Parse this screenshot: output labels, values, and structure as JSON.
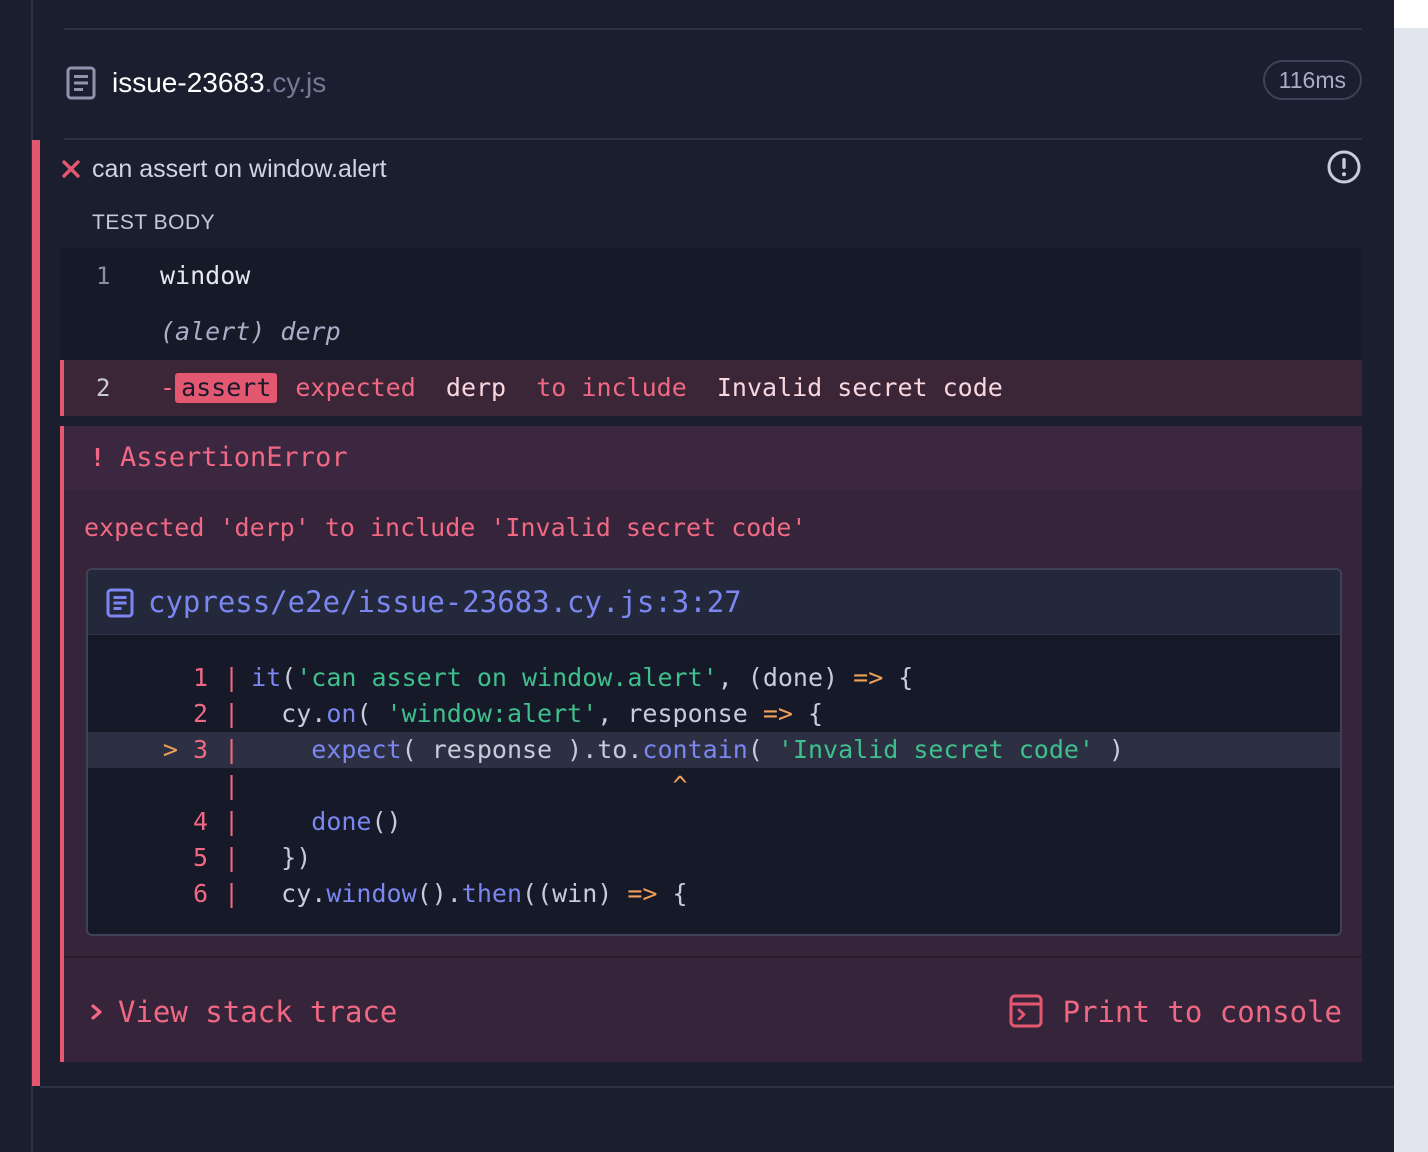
{
  "spec": {
    "name": "issue-23683",
    "extension": ".cy.js",
    "duration": "116ms"
  },
  "test": {
    "title": "can assert on window.alert",
    "status_icon": "x-icon",
    "section_label": "TEST BODY"
  },
  "commands": [
    {
      "number": "1",
      "text": "window"
    },
    {
      "number": "",
      "text": "(alert)  derp"
    },
    {
      "number": "2",
      "dash": "-",
      "name": "assert",
      "message_parts": [
        "expected",
        "derp",
        "to include",
        "Invalid secret code"
      ]
    }
  ],
  "error": {
    "bang": "!",
    "name": "AssertionError",
    "message": "expected 'derp' to include 'Invalid secret code'",
    "file_path": "cypress/e2e/issue-23683.cy.js:3:27"
  },
  "code_lines": [
    {
      "gutter": "1",
      "pointer": "",
      "tokens": [
        [
          "fn",
          "it"
        ],
        [
          "plain",
          "("
        ],
        [
          "str",
          "'can assert on window.alert'"
        ],
        [
          "plain",
          ", (done) "
        ],
        [
          "arrow",
          "=>"
        ],
        [
          "plain",
          " {"
        ]
      ]
    },
    {
      "gutter": "2",
      "pointer": "",
      "tokens": [
        [
          "plain",
          "  cy."
        ],
        [
          "fn",
          "on"
        ],
        [
          "plain",
          "( "
        ],
        [
          "str",
          "'window:alert'"
        ],
        [
          "plain",
          ", response "
        ],
        [
          "arrow",
          "=>"
        ],
        [
          "plain",
          " {"
        ]
      ]
    },
    {
      "gutter": "3",
      "pointer": ">",
      "active": true,
      "tokens": [
        [
          "plain",
          "    "
        ],
        [
          "fn",
          "expect"
        ],
        [
          "plain",
          "( response ).to."
        ],
        [
          "fn",
          "contain"
        ],
        [
          "plain",
          "( "
        ],
        [
          "str",
          "'Invalid secret code'"
        ],
        [
          "plain",
          " )"
        ]
      ]
    },
    {
      "gutter": "",
      "pointer": "",
      "tokens": [
        [
          "caret",
          "                            ^"
        ]
      ]
    },
    {
      "gutter": "4",
      "pointer": "",
      "tokens": [
        [
          "plain",
          "    "
        ],
        [
          "fn",
          "done"
        ],
        [
          "plain",
          "()"
        ]
      ]
    },
    {
      "gutter": "5",
      "pointer": "",
      "tokens": [
        [
          "plain",
          "  })"
        ]
      ]
    },
    {
      "gutter": "6",
      "pointer": "",
      "tokens": [
        [
          "plain",
          "  cy."
        ],
        [
          "fn",
          "window"
        ],
        [
          "plain",
          "()."
        ],
        [
          "fn",
          "then"
        ],
        [
          "plain",
          "((win) "
        ],
        [
          "arrow",
          "=>"
        ],
        [
          "plain",
          " {"
        ]
      ]
    }
  ],
  "actions": {
    "view_stack_trace": "View stack trace",
    "print_to_console": "Print to console"
  },
  "colors": {
    "fail": "#e45770",
    "background": "#1b1e2e",
    "link": "#7b86f0",
    "string": "#3fbf8c",
    "operator": "#f0a05a"
  }
}
